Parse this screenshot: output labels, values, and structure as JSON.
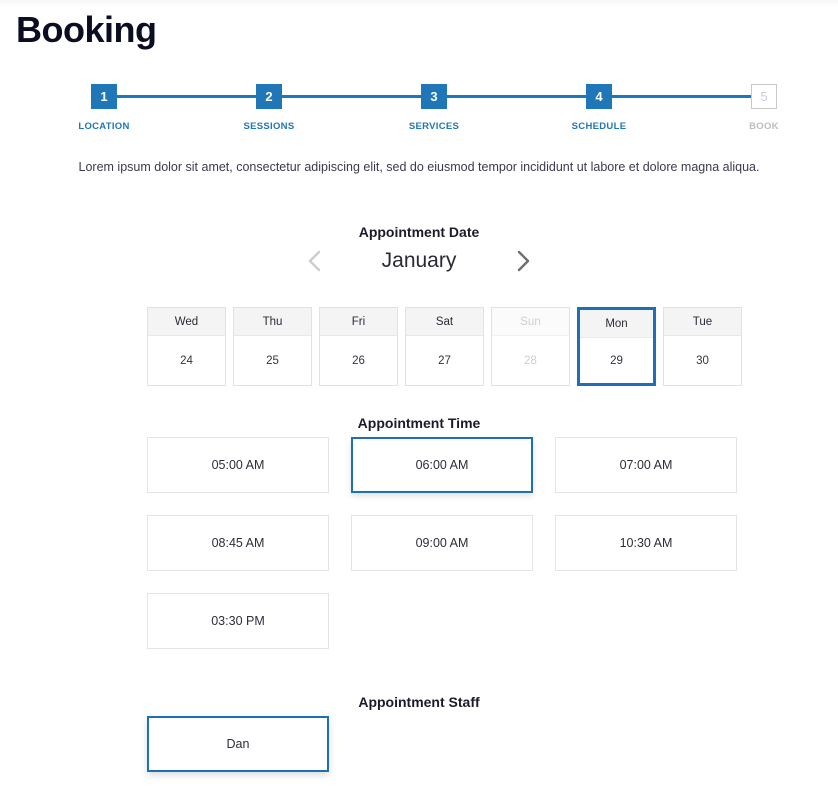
{
  "page": {
    "title": "Booking",
    "intro": "Lorem ipsum dolor sit amet, consectetur adipiscing elit, sed do eiusmod tempor incididunt ut labore et dolore magna aliqua."
  },
  "colors": {
    "accent": "#1f77b8",
    "accent_border": "#1f6fb5",
    "disabled_text": "#cfcfcf",
    "title": "#0b0d23"
  },
  "stepper": {
    "steps": [
      {
        "number": "1",
        "label": "LOCATION",
        "state": "active"
      },
      {
        "number": "2",
        "label": "SESSIONS",
        "state": "active"
      },
      {
        "number": "3",
        "label": "SERVICES",
        "state": "active"
      },
      {
        "number": "4",
        "label": "SCHEDULE",
        "state": "active"
      },
      {
        "number": "5",
        "label": "BOOK",
        "state": "inactive"
      }
    ]
  },
  "appointment_date": {
    "heading": "Appointment Date",
    "month": "January",
    "prev_icon": "chevron-left-icon",
    "next_icon": "chevron-right-icon",
    "days": [
      {
        "dow": "Wed",
        "num": "24",
        "state": "enabled"
      },
      {
        "dow": "Thu",
        "num": "25",
        "state": "enabled"
      },
      {
        "dow": "Fri",
        "num": "26",
        "state": "enabled"
      },
      {
        "dow": "Sat",
        "num": "27",
        "state": "enabled"
      },
      {
        "dow": "Sun",
        "num": "28",
        "state": "disabled"
      },
      {
        "dow": "Mon",
        "num": "29",
        "state": "selected"
      },
      {
        "dow": "Tue",
        "num": "30",
        "state": "enabled"
      }
    ]
  },
  "appointment_time": {
    "heading": "Appointment Time",
    "slots": [
      {
        "label": "05:00 AM",
        "state": "enabled"
      },
      {
        "label": "06:00 AM",
        "state": "selected"
      },
      {
        "label": "07:00 AM",
        "state": "enabled"
      },
      {
        "label": "08:45 AM",
        "state": "enabled"
      },
      {
        "label": "09:00 AM",
        "state": "enabled"
      },
      {
        "label": "10:30 AM",
        "state": "enabled"
      },
      {
        "label": "03:30 PM",
        "state": "enabled"
      }
    ]
  },
  "appointment_staff": {
    "heading": "Appointment Staff",
    "members": [
      {
        "label": "Dan",
        "state": "selected"
      }
    ]
  }
}
